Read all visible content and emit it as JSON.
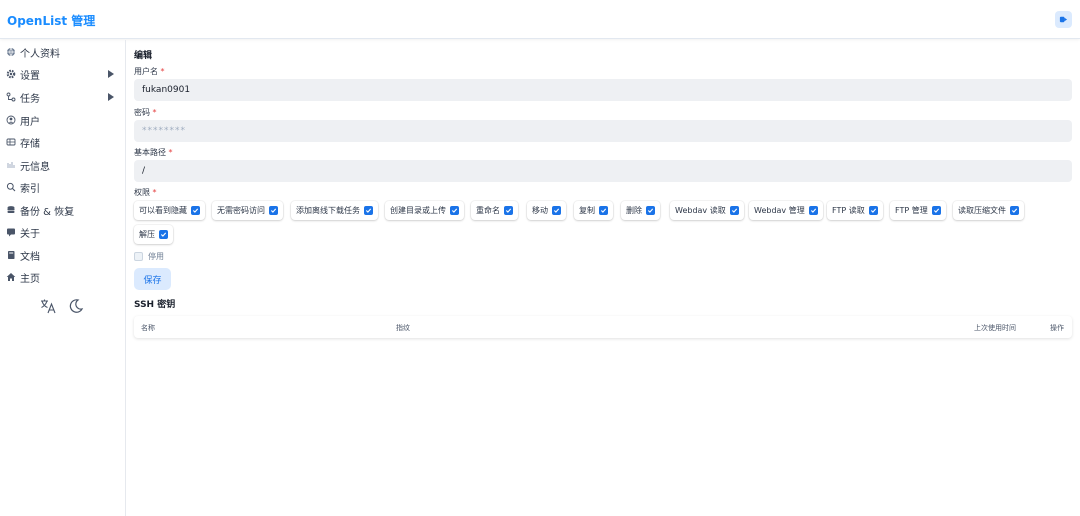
{
  "header": {
    "brand": "OpenList 管理"
  },
  "sidebar": {
    "items": [
      {
        "label": "个人资料",
        "icon": "globe-icon"
      },
      {
        "label": "设置",
        "icon": "gear-icon",
        "expandable": true
      },
      {
        "label": "任务",
        "icon": "tasks-icon",
        "expandable": true
      },
      {
        "label": "用户",
        "icon": "user-circle-icon"
      },
      {
        "label": "存储",
        "icon": "database-icon"
      },
      {
        "label": "元信息",
        "icon": "meta-icon"
      },
      {
        "label": "索引",
        "icon": "search-icon"
      },
      {
        "label": "备份 & 恢复",
        "icon": "backup-icon"
      },
      {
        "label": "关于",
        "icon": "info-icon"
      },
      {
        "label": "文档",
        "icon": "book-icon"
      },
      {
        "label": "主页",
        "icon": "home-icon"
      }
    ]
  },
  "form": {
    "title": "编辑",
    "username_label": "用户名",
    "username_value": "fukan0901",
    "password_label": "密码",
    "password_value": "********",
    "basepath_label": "基本路径",
    "basepath_value": "/",
    "perm_label": "权限",
    "required_mark": "*",
    "permissions": [
      {
        "label": "可以看到隐藏",
        "checked": true
      },
      {
        "label": "无需密码访问",
        "checked": true
      },
      {
        "label": "添加离线下载任务",
        "checked": true
      },
      {
        "label": "创建目录或上传",
        "checked": true
      },
      {
        "label": "重命名",
        "checked": true
      },
      {
        "label": "移动",
        "checked": true
      },
      {
        "label": "复制",
        "checked": true
      },
      {
        "label": "删除",
        "checked": true
      },
      {
        "label": "Webdav 读取",
        "checked": true
      },
      {
        "label": "Webdav 管理",
        "checked": true
      },
      {
        "label": "FTP 读取",
        "checked": true
      },
      {
        "label": "FTP 管理",
        "checked": true
      },
      {
        "label": "读取压缩文件",
        "checked": true
      },
      {
        "label": "解压",
        "checked": true
      }
    ],
    "disable_label": "停用",
    "save_label": "保存"
  },
  "ssh": {
    "title": "SSH 密钥",
    "columns": [
      "名称",
      "指纹",
      "上次使用时间",
      "操作"
    ]
  },
  "colors": {
    "accent": "#1a73e8",
    "brand": "#1a8cff",
    "input_bg": "#eef0f3"
  }
}
